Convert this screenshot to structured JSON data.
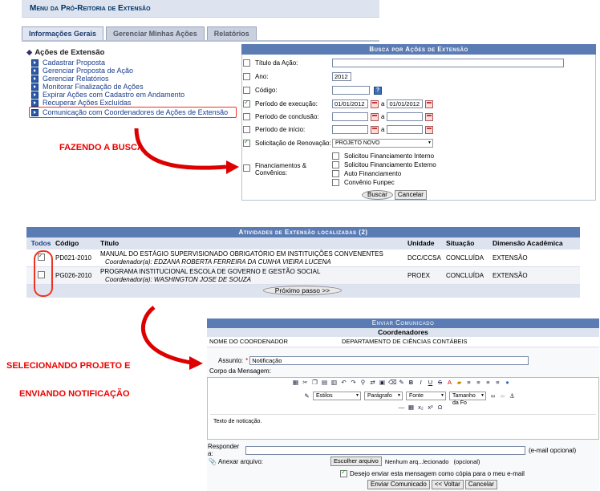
{
  "menu": {
    "title": "Menu da Pró-Reitoria de Extensão",
    "tabs": [
      "Informações Gerais",
      "Gerenciar Minhas Ações",
      "Relatórios"
    ],
    "section_title": "Ações de Extensão",
    "items": [
      "Cadastrar Proposta",
      "Gerenciar Proposta de Ação",
      "Gerenciar Relatórios",
      "Monitorar Finalização de Ações",
      "Expirar Ações com Cadastro em Andamento",
      "Recuperar Ações Excluídas",
      "Comunicação com Coordenadores de Ações de Extensão"
    ]
  },
  "annotations": {
    "search": "FAZENDO A BUSCA",
    "select1": "SELECIONANDO PROJETO E",
    "select2": "ENVIANDO NOTIFICAÇÃO"
  },
  "search_form": {
    "title": "Busca por Ações de Extensão",
    "labels": {
      "titulo": "Título da Ação:",
      "ano": "Ano:",
      "codigo": "Código:",
      "periodo_exec": "Período de execução:",
      "periodo_conc": "Período de conclusão:",
      "periodo_inicio": "Período de início:",
      "renovacao": "Solicitação de Renovação:",
      "financiamentos": "Financiamentos & Convênios:"
    },
    "values": {
      "ano": "2012",
      "exec_from": "01/01/2012",
      "exec_to": "01/01/2012",
      "renovacao": "PROJETO NOVO",
      "sep": "a"
    },
    "fin_options": [
      "Solicitou Financiamento Interno",
      "Solicitou Financiamento Externo",
      "Auto Financiamento",
      "Convênio Funpec"
    ],
    "buttons": {
      "search": "Buscar",
      "cancel": "Cancelar"
    }
  },
  "results": {
    "title": "Atividades de Extensão localizadas (2)",
    "columns": [
      "Todos",
      "Código",
      "Título",
      "Unidade",
      "Situação",
      "Dimensão Acadêmica"
    ],
    "rows": [
      {
        "codigo": "PD021-2010",
        "titulo": "MANUAL DO ESTÁGIO SUPERVISIONADO OBRIGATÓRIO EM INSTITUIÇÕES CONVENENTES",
        "coord": "Coordenador(a): EDZANA ROBERTA FERREIRA DA CUNHA VIEIRA LUCENA",
        "unidade": "DCC/CCSA",
        "situacao": "CONCLUÍDA",
        "dimensao": "EXTENSÃO"
      },
      {
        "codigo": "PG026-2010",
        "titulo": "PROGRAMA INSTITUCIONAL ESCOLA DE GOVERNO E GESTÃO SOCIAL",
        "coord": "Coordenador(a): WASHINGTON JOSE DE SOUZA",
        "unidade": "PROEX",
        "situacao": "CONCLUÍDA",
        "dimensao": "EXTENSÃO"
      }
    ],
    "next_button": "Próximo passo >>"
  },
  "notice": {
    "title": "Enviar Comunicado",
    "subtitle": "Coordenadores",
    "recipient_name": "NOME DO COORDENADOR",
    "recipient_dept": "DEPARTAMENTO DE CIÊNCIAS CONTÁBEIS",
    "assunto_label": "Assunto:",
    "assunto_value": "Notificação",
    "corpo_label": "Corpo da Mensagem:",
    "toolbar_selects": [
      "Estilos",
      "Parágrafo",
      "Fonte",
      "Tamanho da Fo"
    ],
    "body_text": "Texto de noticação.",
    "responder_label": "Responder a:",
    "email_hint": "(e-mail opcional)",
    "anexar_label": "Anexar arquivo:",
    "file_button": "Escolher arquivo",
    "file_status": "Nenhum arq...lecionado",
    "file_hint": "(opcional)",
    "copy_label": "Desejo enviar esta mensagem como cópia para o meu e-mail",
    "buttons": {
      "send": "Enviar Comunicado",
      "back": "<< Voltar",
      "cancel": "Cancelar"
    }
  }
}
